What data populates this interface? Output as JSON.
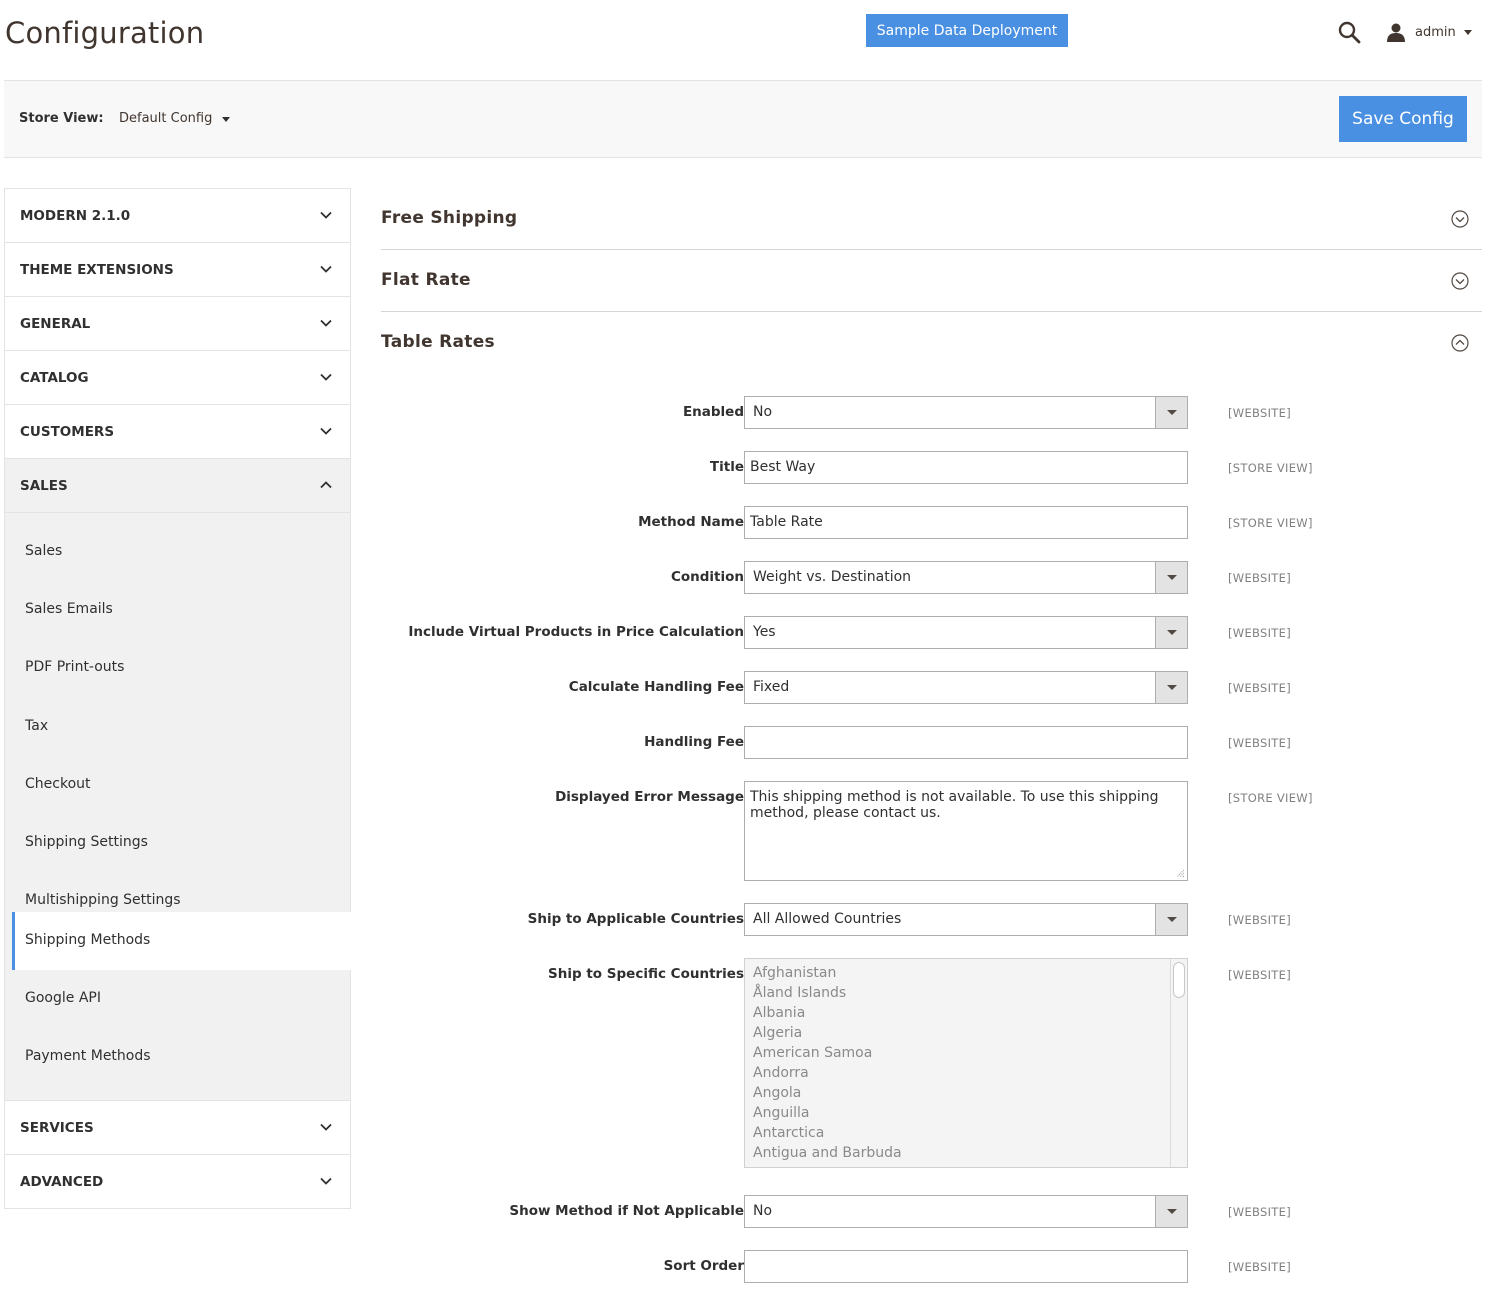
{
  "header": {
    "title": "Configuration",
    "sample_button": "Sample Data Deployment",
    "user_name": "admin"
  },
  "store_bar": {
    "label": "Store View:",
    "selected": "Default Config",
    "save_label": "Save Config"
  },
  "sidebar": {
    "groups": [
      {
        "label": "MODERN 2.1.0"
      },
      {
        "label": "THEME EXTENSIONS"
      },
      {
        "label": "GENERAL"
      },
      {
        "label": "CATALOG"
      },
      {
        "label": "CUSTOMERS"
      },
      {
        "label": "SALES"
      },
      {
        "label": "SERVICES"
      },
      {
        "label": "ADVANCED"
      }
    ],
    "sales_items": [
      {
        "label": "Sales"
      },
      {
        "label": "Sales Emails"
      },
      {
        "label": "PDF Print-outs"
      },
      {
        "label": "Tax"
      },
      {
        "label": "Checkout"
      },
      {
        "label": "Shipping Settings"
      },
      {
        "label": "Multishipping Settings"
      },
      {
        "label": "Shipping Methods"
      },
      {
        "label": "Google API"
      },
      {
        "label": "Payment Methods"
      }
    ]
  },
  "sections": [
    {
      "title": "Free Shipping"
    },
    {
      "title": "Flat Rate"
    },
    {
      "title": "Table Rates"
    }
  ],
  "fields": {
    "enabled": {
      "label": "Enabled",
      "value": "No",
      "scope": "[WEBSITE]"
    },
    "title": {
      "label": "Title",
      "value": "Best Way",
      "scope": "[STORE VIEW]"
    },
    "method_name": {
      "label": "Method Name",
      "value": "Table Rate",
      "scope": "[STORE VIEW]"
    },
    "condition": {
      "label": "Condition",
      "value": "Weight vs. Destination",
      "scope": "[WEBSITE]"
    },
    "include_virtual": {
      "label": "Include Virtual Products in Price Calculation",
      "value": "Yes",
      "scope": "[WEBSITE]"
    },
    "handling_type": {
      "label": "Calculate Handling Fee",
      "value": "Fixed",
      "scope": "[WEBSITE]"
    },
    "handling_fee": {
      "label": "Handling Fee",
      "value": "",
      "scope": "[WEBSITE]"
    },
    "error_message": {
      "label": "Displayed Error Message",
      "value": "This shipping method is not available. To use this shipping method, please contact us.",
      "scope": "[STORE VIEW]"
    },
    "applicable_countries": {
      "label": "Ship to Applicable Countries",
      "value": "All Allowed Countries",
      "scope": "[WEBSITE]"
    },
    "specific_countries": {
      "label": "Ship to Specific Countries",
      "scope": "[WEBSITE]",
      "options": [
        "Afghanistan",
        "Åland Islands",
        "Albania",
        "Algeria",
        "American Samoa",
        "Andorra",
        "Angola",
        "Anguilla",
        "Antarctica",
        "Antigua and Barbuda"
      ]
    },
    "show_method": {
      "label": "Show Method if Not Applicable",
      "value": "No",
      "scope": "[WEBSITE]"
    },
    "sort_order": {
      "label": "Sort Order",
      "value": "",
      "scope": "[WEBSITE]"
    }
  }
}
